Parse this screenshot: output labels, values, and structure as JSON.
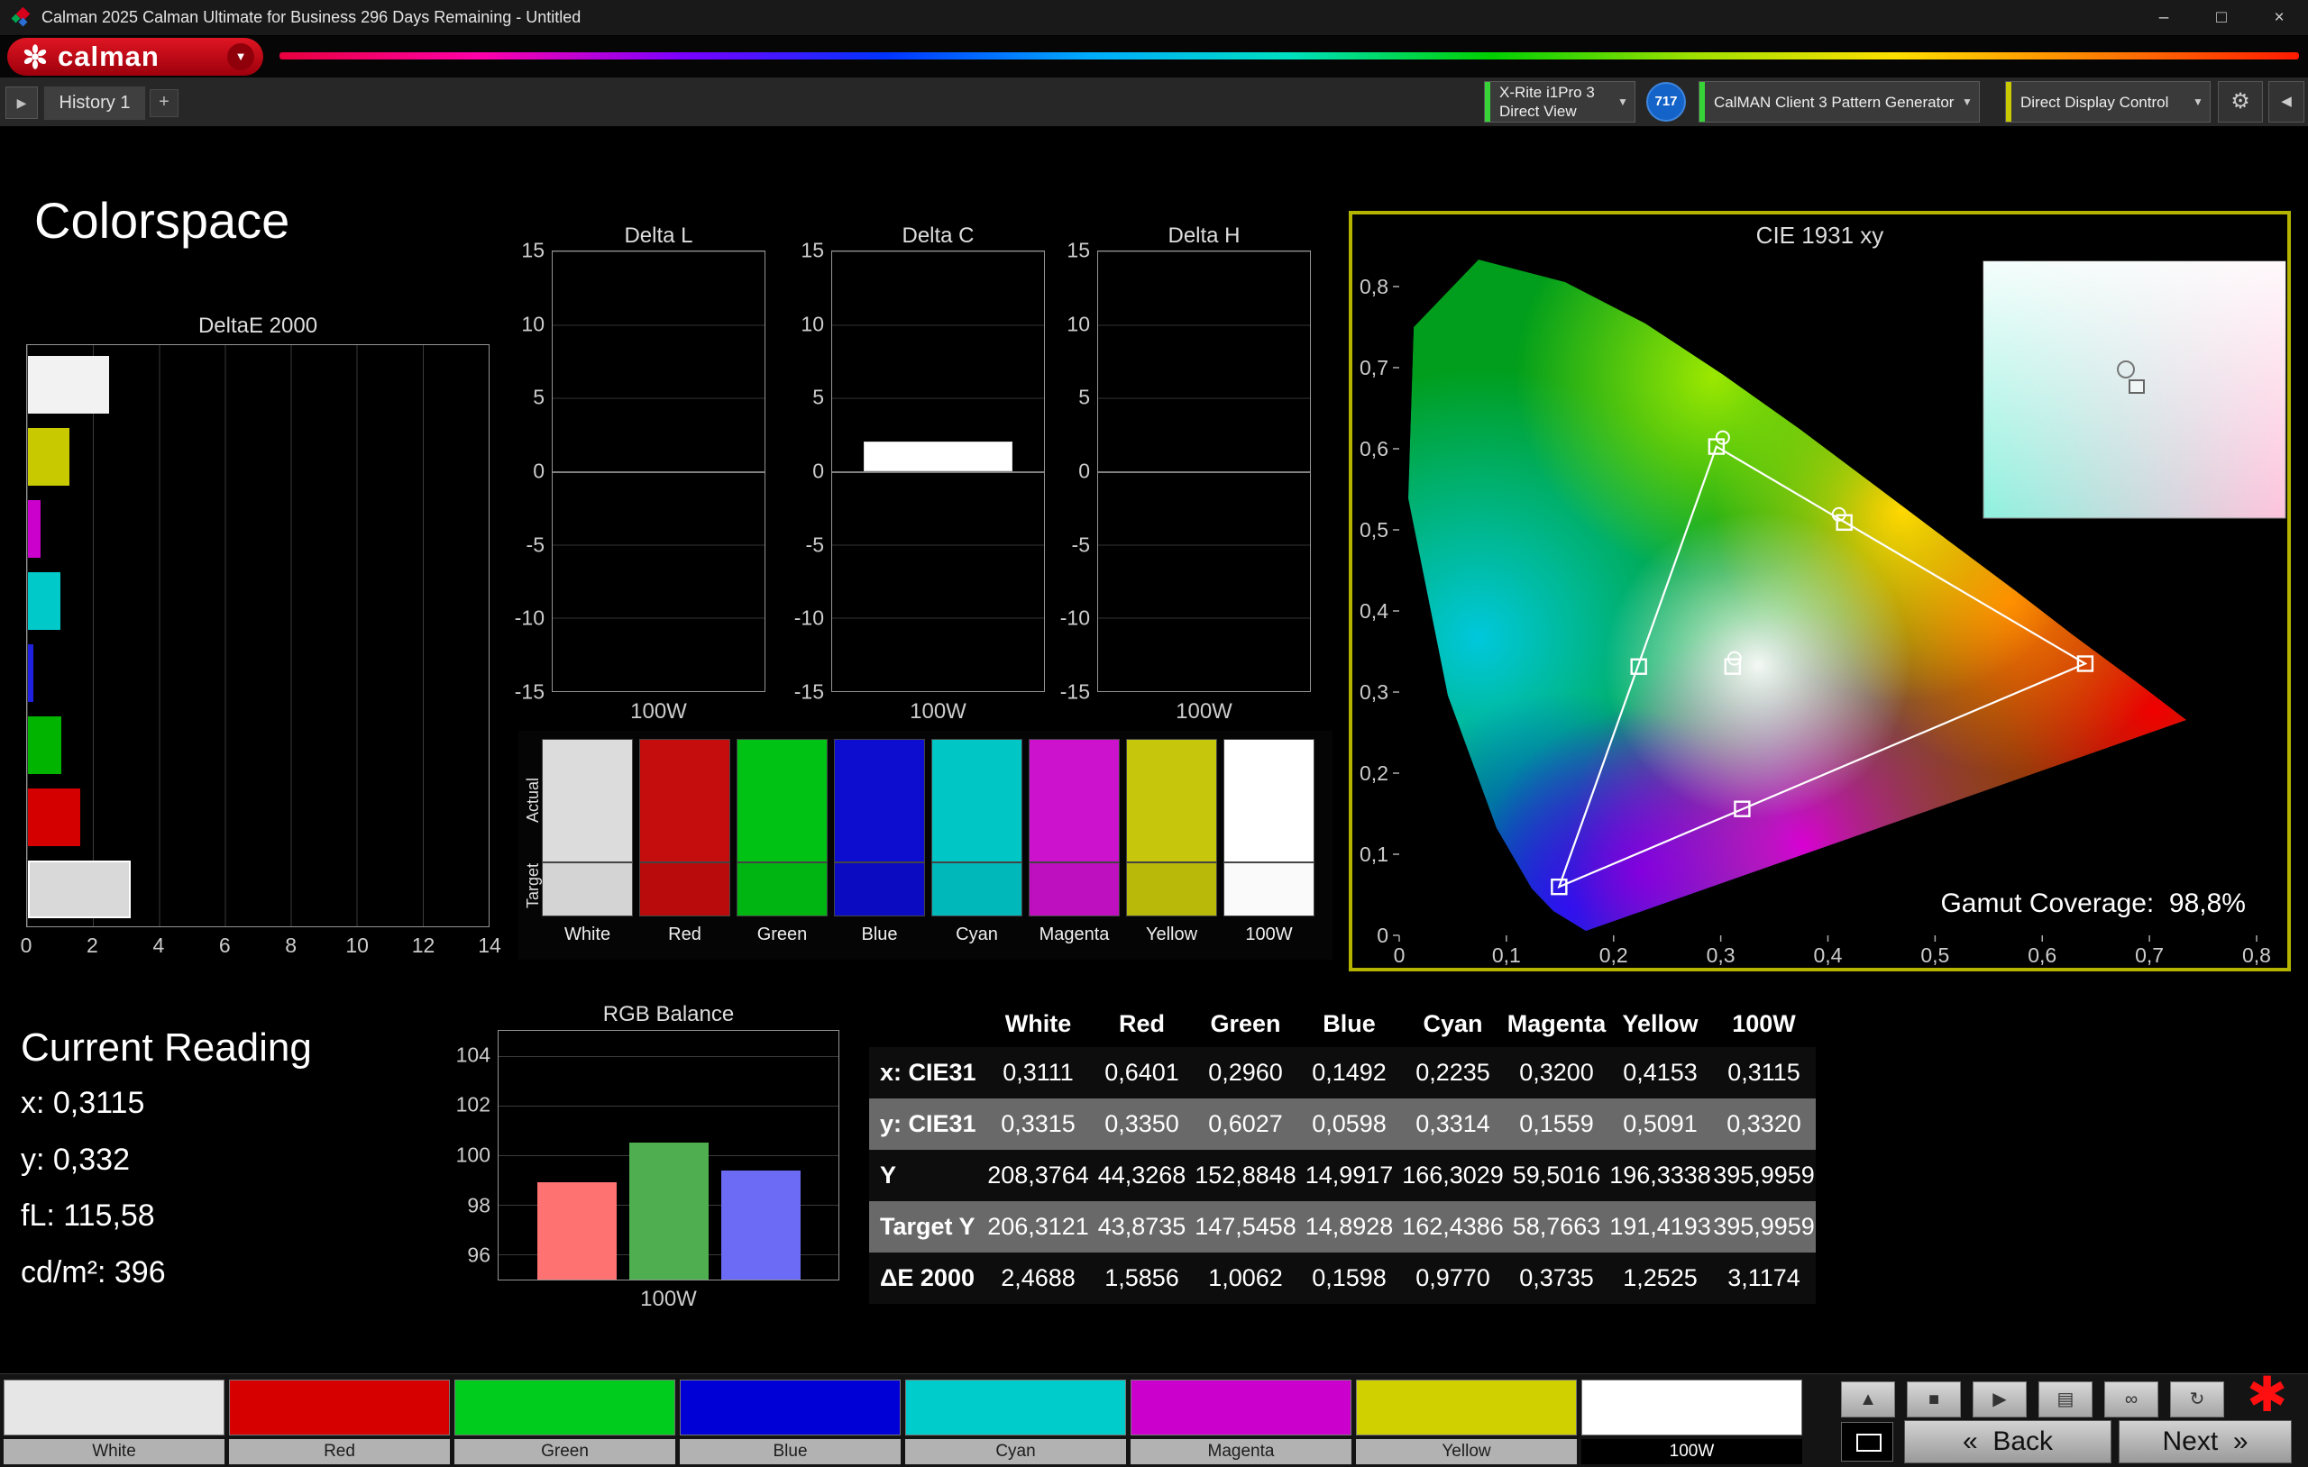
{
  "window": {
    "title": "Calman 2025 Calman Ultimate for Business 296 Days Remaining  - Untitled",
    "minimize": "–",
    "maximize": "□",
    "close": "×"
  },
  "brand": {
    "logo_text": "calman",
    "logo_arrow": "▼"
  },
  "tabs": {
    "nav_arrow": "▶",
    "history": "History 1",
    "add": "+"
  },
  "toolbar": {
    "meter_line1": "X-Rite i1Pro 3",
    "meter_line2": "Direct View",
    "meter_arrow": "▼",
    "badge": "717",
    "pattern_source": "CalMAN Client 3 Pattern Generator",
    "pattern_arrow": "▼",
    "display_control": "Direct Display Control",
    "display_arrow": "▼",
    "gear": "⚙",
    "collapse": "◀"
  },
  "page": {
    "title": "Colorspace"
  },
  "chart_data": [
    {
      "type": "bar",
      "title": "DeltaE 2000",
      "orientation": "horizontal",
      "xlim": [
        0,
        14
      ],
      "xticks": [
        "0",
        "2",
        "4",
        "6",
        "8",
        "10",
        "12",
        "14"
      ],
      "categories": [
        "White",
        "Yellow",
        "Magenta",
        "Cyan",
        "Blue",
        "Green",
        "Red",
        "100W"
      ],
      "values": [
        2.4688,
        1.2525,
        0.3735,
        0.977,
        0.1598,
        1.0062,
        1.5856,
        3.1174
      ],
      "colors": [
        "#f2f2f2",
        "#c9c900",
        "#cc00cc",
        "#00c9c9",
        "#2020e0",
        "#00b400",
        "#d40000",
        "#d9d9d9"
      ]
    },
    {
      "type": "bar",
      "title": "Delta L",
      "footer": "100W",
      "ylim": [
        -15,
        15
      ],
      "yticks": [
        "15",
        "10",
        "5",
        "0",
        "-5",
        "-10",
        "-15"
      ],
      "values": [
        0
      ]
    },
    {
      "type": "bar",
      "title": "Delta C",
      "footer": "100W",
      "ylim": [
        -15,
        15
      ],
      "yticks": [
        "15",
        "10",
        "5",
        "0",
        "-5",
        "-10",
        "-15"
      ],
      "values": [
        2.0
      ]
    },
    {
      "type": "bar",
      "title": "Delta H",
      "footer": "100W",
      "ylim": [
        -15,
        15
      ],
      "yticks": [
        "15",
        "10",
        "5",
        "0",
        "-5",
        "-10",
        "-15"
      ],
      "values": [
        0
      ]
    },
    {
      "type": "bar",
      "title": "RGB Balance",
      "footer": "100W",
      "ylim": [
        95,
        105
      ],
      "yticks": [
        {
          "label": "104",
          "value": 104
        },
        {
          "label": "102",
          "value": 102
        },
        {
          "label": "100",
          "value": 100
        },
        {
          "label": "98",
          "value": 98
        },
        {
          "label": "96",
          "value": 96
        }
      ],
      "categories": [
        "Red",
        "Green",
        "Blue"
      ],
      "values": [
        98.9,
        100.5,
        99.4
      ],
      "colors": [
        "#ff7272",
        "#4fae4f",
        "#6b6bf5"
      ]
    },
    {
      "type": "scatter",
      "title": "CIE 1931 xy",
      "xlim": [
        0,
        0.8
      ],
      "ylim": [
        0,
        0.8
      ],
      "xticks": [
        "0",
        "0,1",
        "0,2",
        "0,3",
        "0,4",
        "0,5",
        "0,6",
        "0,7",
        "0,8"
      ],
      "yticks": [
        "0,8",
        "0,7",
        "0,6",
        "0,5",
        "0,4",
        "0,3",
        "0,2",
        "0,1",
        "0"
      ],
      "gamut_label": "Gamut Coverage:",
      "gamut_value": "98,8%",
      "triangle": [
        "red",
        "green",
        "blue"
      ],
      "points": [
        {
          "name": "white",
          "x": 0.3111,
          "y": 0.3315,
          "circle": [
            2,
            -9
          ]
        },
        {
          "name": "red",
          "x": 0.6401,
          "y": 0.335
        },
        {
          "name": "green",
          "x": 0.296,
          "y": 0.6027,
          "circle": [
            7,
            -10
          ]
        },
        {
          "name": "blue",
          "x": 0.1492,
          "y": 0.0598
        },
        {
          "name": "cyan",
          "x": 0.2235,
          "y": 0.3314
        },
        {
          "name": "magenta",
          "x": 0.32,
          "y": 0.1559
        },
        {
          "name": "yellow",
          "x": 0.4153,
          "y": 0.5091,
          "circle": [
            -6,
            -9
          ]
        }
      ]
    }
  ],
  "swatches": {
    "actual_label": "Actual",
    "target_label": "Target",
    "items": [
      {
        "label": "White",
        "actual": "#dcdcdc",
        "target": "#d4d4d4"
      },
      {
        "label": "Red",
        "actual": "#c60d0d",
        "target": "#b90b0b"
      },
      {
        "label": "Green",
        "actual": "#00c214",
        "target": "#00b412"
      },
      {
        "label": "Blue",
        "actual": "#0d0dd0",
        "target": "#0b0bc2"
      },
      {
        "label": "Cyan",
        "actual": "#00c6c6",
        "target": "#00b8ba"
      },
      {
        "label": "Magenta",
        "actual": "#cc12cc",
        "target": "#bf10bf"
      },
      {
        "label": "Yellow",
        "actual": "#c6c60c",
        "target": "#b9b90a"
      },
      {
        "label": "100W",
        "actual": "#ffffff",
        "target": "#fafafa"
      }
    ]
  },
  "table": {
    "headers": [
      "White",
      "Red",
      "Green",
      "Blue",
      "Cyan",
      "Magenta",
      "Yellow",
      "100W"
    ],
    "rows": [
      {
        "label": "x: CIE31",
        "values": [
          "0,3111",
          "0,6401",
          "0,2960",
          "0,1492",
          "0,2235",
          "0,3200",
          "0,4153",
          "0,3115"
        ]
      },
      {
        "label": "y: CIE31",
        "values": [
          "0,3315",
          "0,3350",
          "0,6027",
          "0,0598",
          "0,3314",
          "0,1559",
          "0,5091",
          "0,3320"
        ]
      },
      {
        "label": "Y",
        "values": [
          "208,3764",
          "44,3268",
          "152,8848",
          "14,9917",
          "166,3029",
          "59,5016",
          "196,3338",
          "395,9959"
        ]
      },
      {
        "label": "Target Y",
        "values": [
          "206,3121",
          "43,8735",
          "147,5458",
          "14,8928",
          "162,4386",
          "58,7663",
          "191,4193",
          "395,9959"
        ]
      },
      {
        "label": "ΔE 2000",
        "values": [
          "2,4688",
          "1,5856",
          "1,0062",
          "0,1598",
          "0,9770",
          "0,3735",
          "1,2525",
          "3,1174"
        ]
      }
    ]
  },
  "current_reading": {
    "title": "Current Reading",
    "x": "x: 0,3115",
    "y": "y: 0,332",
    "fl": "fL: 115,58",
    "cdm2": "cd/m²: 396"
  },
  "bottom": {
    "patches": [
      {
        "label": "White",
        "color": "#e6e6e6"
      },
      {
        "label": "Red",
        "color": "#d60000"
      },
      {
        "label": "Green",
        "color": "#00cc1e"
      },
      {
        "label": "Blue",
        "color": "#0000d6"
      },
      {
        "label": "Cyan",
        "color": "#00cccc"
      },
      {
        "label": "Magenta",
        "color": "#cc00cc"
      },
      {
        "label": "Yellow",
        "color": "#d0d000"
      },
      {
        "label": "100W",
        "color": "#ffffff",
        "selected": true
      }
    ],
    "controls": [
      {
        "name": "eject-button",
        "glyph": "▲"
      },
      {
        "name": "stop-button",
        "glyph": "■"
      },
      {
        "name": "play-button",
        "glyph": "▶"
      },
      {
        "name": "pattern-grid-button",
        "glyph": "▤"
      },
      {
        "name": "loop-button",
        "glyph": "∞"
      },
      {
        "name": "refresh-button",
        "glyph": "↻"
      }
    ],
    "back_chevron": "«",
    "back_label": "Back",
    "next_label": "Next",
    "next_chevron": "»",
    "asterisk": "✱"
  }
}
